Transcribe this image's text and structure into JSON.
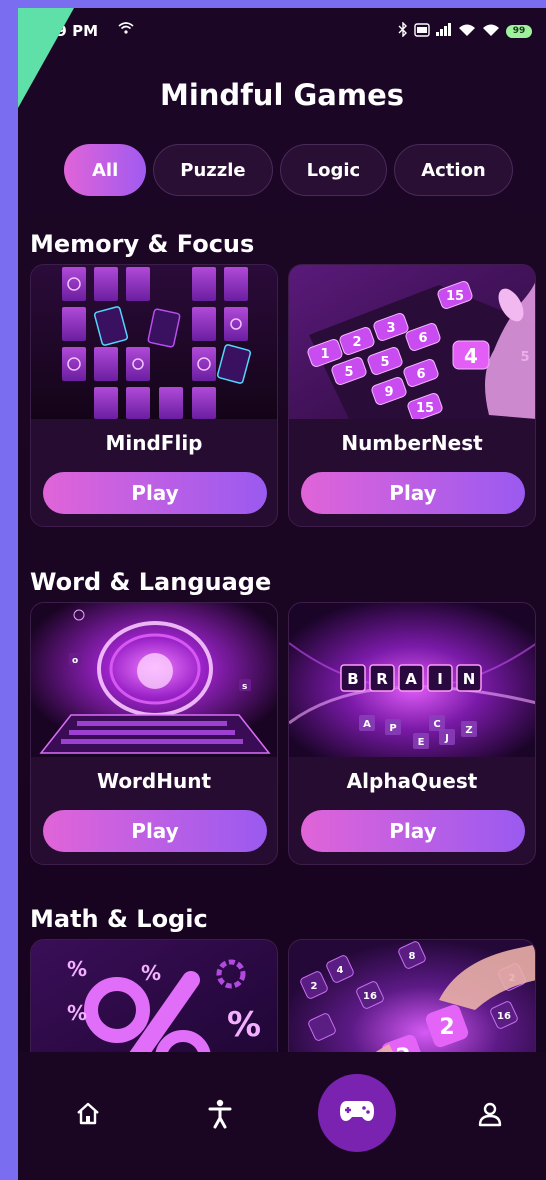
{
  "status": {
    "time": ":59 PM",
    "battery": "99"
  },
  "title": "Mindful Games",
  "filters": [
    {
      "label": "All",
      "active": true
    },
    {
      "label": "Puzzle",
      "active": false
    },
    {
      "label": "Logic",
      "active": false
    },
    {
      "label": "Action",
      "active": false
    }
  ],
  "sections": [
    {
      "title": "Memory & Focus",
      "games": [
        {
          "name": "MindFlip",
          "play_label": "Play"
        },
        {
          "name": "NumberNest",
          "play_label": "Play"
        }
      ]
    },
    {
      "title": "Word & Language",
      "games": [
        {
          "name": "WordHunt",
          "play_label": "Play"
        },
        {
          "name": "AlphaQuest",
          "play_label": "Play"
        }
      ]
    },
    {
      "title": "Math & Logic",
      "games": [
        {
          "name": "",
          "play_label": ""
        },
        {
          "name": "",
          "play_label": ""
        }
      ]
    }
  ],
  "art": {
    "numbernest_tiles": [
      "1",
      "2",
      "3",
      "6",
      "4",
      "5",
      "6",
      "9",
      "15",
      "15",
      "5",
      "1"
    ],
    "alphaquest_letters": [
      "B",
      "R",
      "A",
      "I",
      "N"
    ],
    "alphaquest_small": [
      "A",
      "P",
      "C",
      "E",
      "J",
      "Z"
    ],
    "mathlogic_symbols": [
      "%",
      "%",
      "%",
      "%"
    ],
    "mathlogic2_tiles": [
      "2",
      "2",
      "16",
      "8",
      "4",
      "2",
      "16"
    ]
  },
  "nav": [
    {
      "icon": "home-icon"
    },
    {
      "icon": "accessibility-icon"
    },
    {
      "icon": "gamepad-icon",
      "active": true
    },
    {
      "icon": "profile-icon"
    }
  ],
  "colors": {
    "background": "#1c0626",
    "accent_start": "#e064d8",
    "accent_end": "#9a5af0",
    "nav_active": "#7a23b0"
  }
}
